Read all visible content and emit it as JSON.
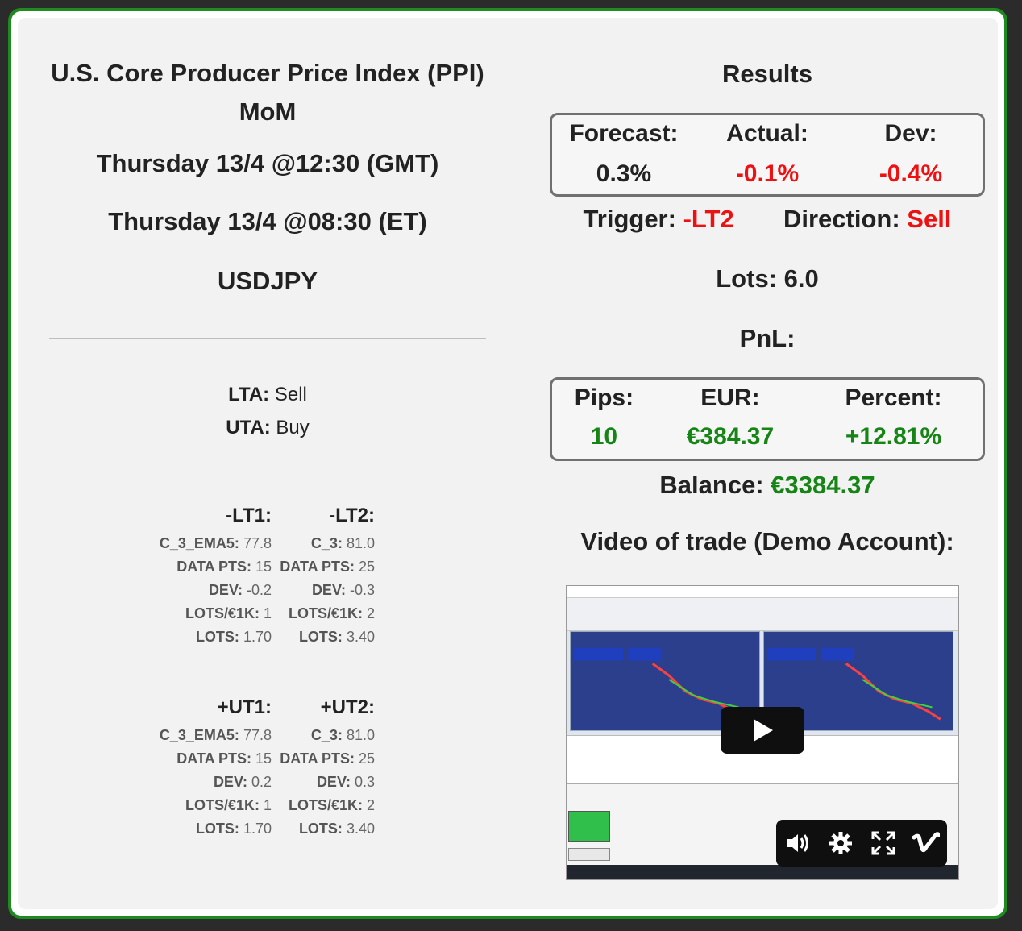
{
  "event": {
    "title": "U.S. Core Producer Price Index (PPI) MoM",
    "time_gmt": "Thursday 13/4 @12:30 (GMT)",
    "time_et": "Thursday 13/4 @08:30 (ET)",
    "pair": "USDJPY"
  },
  "tech_analysis": {
    "lta_label": "LTA:",
    "lta_value": "Sell",
    "uta_label": "UTA:",
    "uta_value": "Buy"
  },
  "triggers": {
    "lt1": {
      "header": "-LT1:",
      "rows": [
        {
          "label": "C_3_EMA5:",
          "value": "77.8"
        },
        {
          "label": "DATA PTS:",
          "value": "15"
        },
        {
          "label": "DEV:",
          "value": "-0.2"
        },
        {
          "label": "LOTS/€1K:",
          "value": "1"
        },
        {
          "label": "LOTS:",
          "value": "1.70"
        }
      ]
    },
    "lt2": {
      "header": "-LT2:",
      "rows": [
        {
          "label": "C_3:",
          "value": "81.0"
        },
        {
          "label": "DATA PTS:",
          "value": "25"
        },
        {
          "label": "DEV:",
          "value": "-0.3"
        },
        {
          "label": "LOTS/€1K:",
          "value": "2"
        },
        {
          "label": "LOTS:",
          "value": "3.40"
        }
      ]
    },
    "ut1": {
      "header": "+UT1:",
      "rows": [
        {
          "label": "C_3_EMA5:",
          "value": "77.8"
        },
        {
          "label": "DATA PTS:",
          "value": "15"
        },
        {
          "label": "DEV:",
          "value": "0.2"
        },
        {
          "label": "LOTS/€1K:",
          "value": "1"
        },
        {
          "label": "LOTS:",
          "value": "1.70"
        }
      ]
    },
    "ut2": {
      "header": "+UT2:",
      "rows": [
        {
          "label": "C_3:",
          "value": "81.0"
        },
        {
          "label": "DATA PTS:",
          "value": "25"
        },
        {
          "label": "DEV:",
          "value": "0.3"
        },
        {
          "label": "LOTS/€1K:",
          "value": "2"
        },
        {
          "label": "LOTS:",
          "value": "3.40"
        }
      ]
    }
  },
  "results": {
    "heading": "Results",
    "forecast_label": "Forecast:",
    "forecast_value": "0.3%",
    "actual_label": "Actual:",
    "actual_value": "-0.1%",
    "dev_label": "Dev:",
    "dev_value": "-0.4%",
    "trigger_label": "Trigger:",
    "trigger_value": "-LT2",
    "direction_label": "Direction:",
    "direction_value": "Sell",
    "lots_label": "Lots:",
    "lots_value": "6.0",
    "pnl_label": "PnL:",
    "pips_label": "Pips:",
    "pips_value": "10",
    "eur_label": "EUR:",
    "eur_value": "€384.37",
    "percent_label": "Percent:",
    "percent_value": "+12.81%",
    "balance_label": "Balance:",
    "balance_value": "€3384.37",
    "video_heading": "Video of trade (Demo Account):"
  },
  "colors": {
    "frame_green": "#1f8a1f",
    "negative_red": "#ee1111",
    "positive_green": "#168516"
  }
}
